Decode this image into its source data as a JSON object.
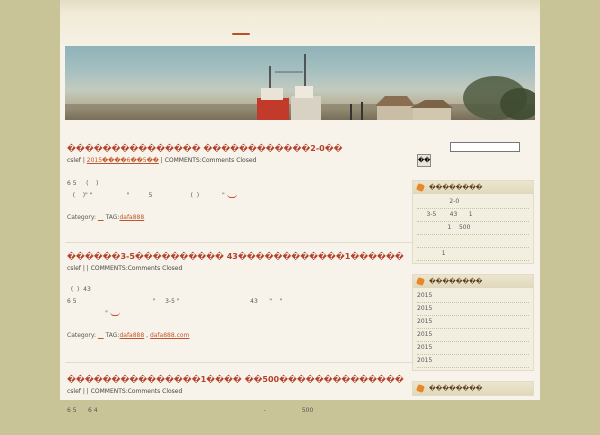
{
  "posts": [
    {
      "title": "��������������� ������������2-0��",
      "author": "cslef",
      "date": "2015����6��5��",
      "comments": "COMMENTS:Comments Closed",
      "body_lines": [
        "6 5     (    )",
        "   (    )\" \"                  \"          5                    (  )            \""
      ],
      "category_label": "Category:",
      "tag_label": "TAG:",
      "tags": [
        "dafa888"
      ]
    },
    {
      "title": "������3-5���������� 43������������1������",
      "author": "cslef",
      "date": "",
      "comments": "COMMENTS:Comments Closed",
      "body_lines": [
        "  (  )  43",
        "6 5                                        \"     3-5 \"                                     43      \"    \"",
        "                    \""
      ],
      "category_label": "Category:",
      "tag_label": "TAG:",
      "tags": [
        "dafa888",
        "dafa888.com"
      ]
    },
    {
      "title": "���������������1���� ��500��������������",
      "author": "cslef",
      "date": "",
      "comments": "COMMENTS:Comments Closed",
      "body_lines": [
        "6 5      6 4                                                                                       -                   500"
      ],
      "category_label": "",
      "tag_label": "",
      "tags": []
    }
  ],
  "sidebar": {
    "search_button": "��",
    "widgets": [
      {
        "title": "��������",
        "items": [
          "                 2-0",
          "     3-5       43      1",
          "                1    500",
          "",
          "             1"
        ]
      },
      {
        "title": "��������",
        "items": [
          "2015",
          "2015",
          "2015",
          "2015",
          "2015",
          "2015"
        ]
      },
      {
        "title": "��������",
        "items": []
      }
    ]
  }
}
